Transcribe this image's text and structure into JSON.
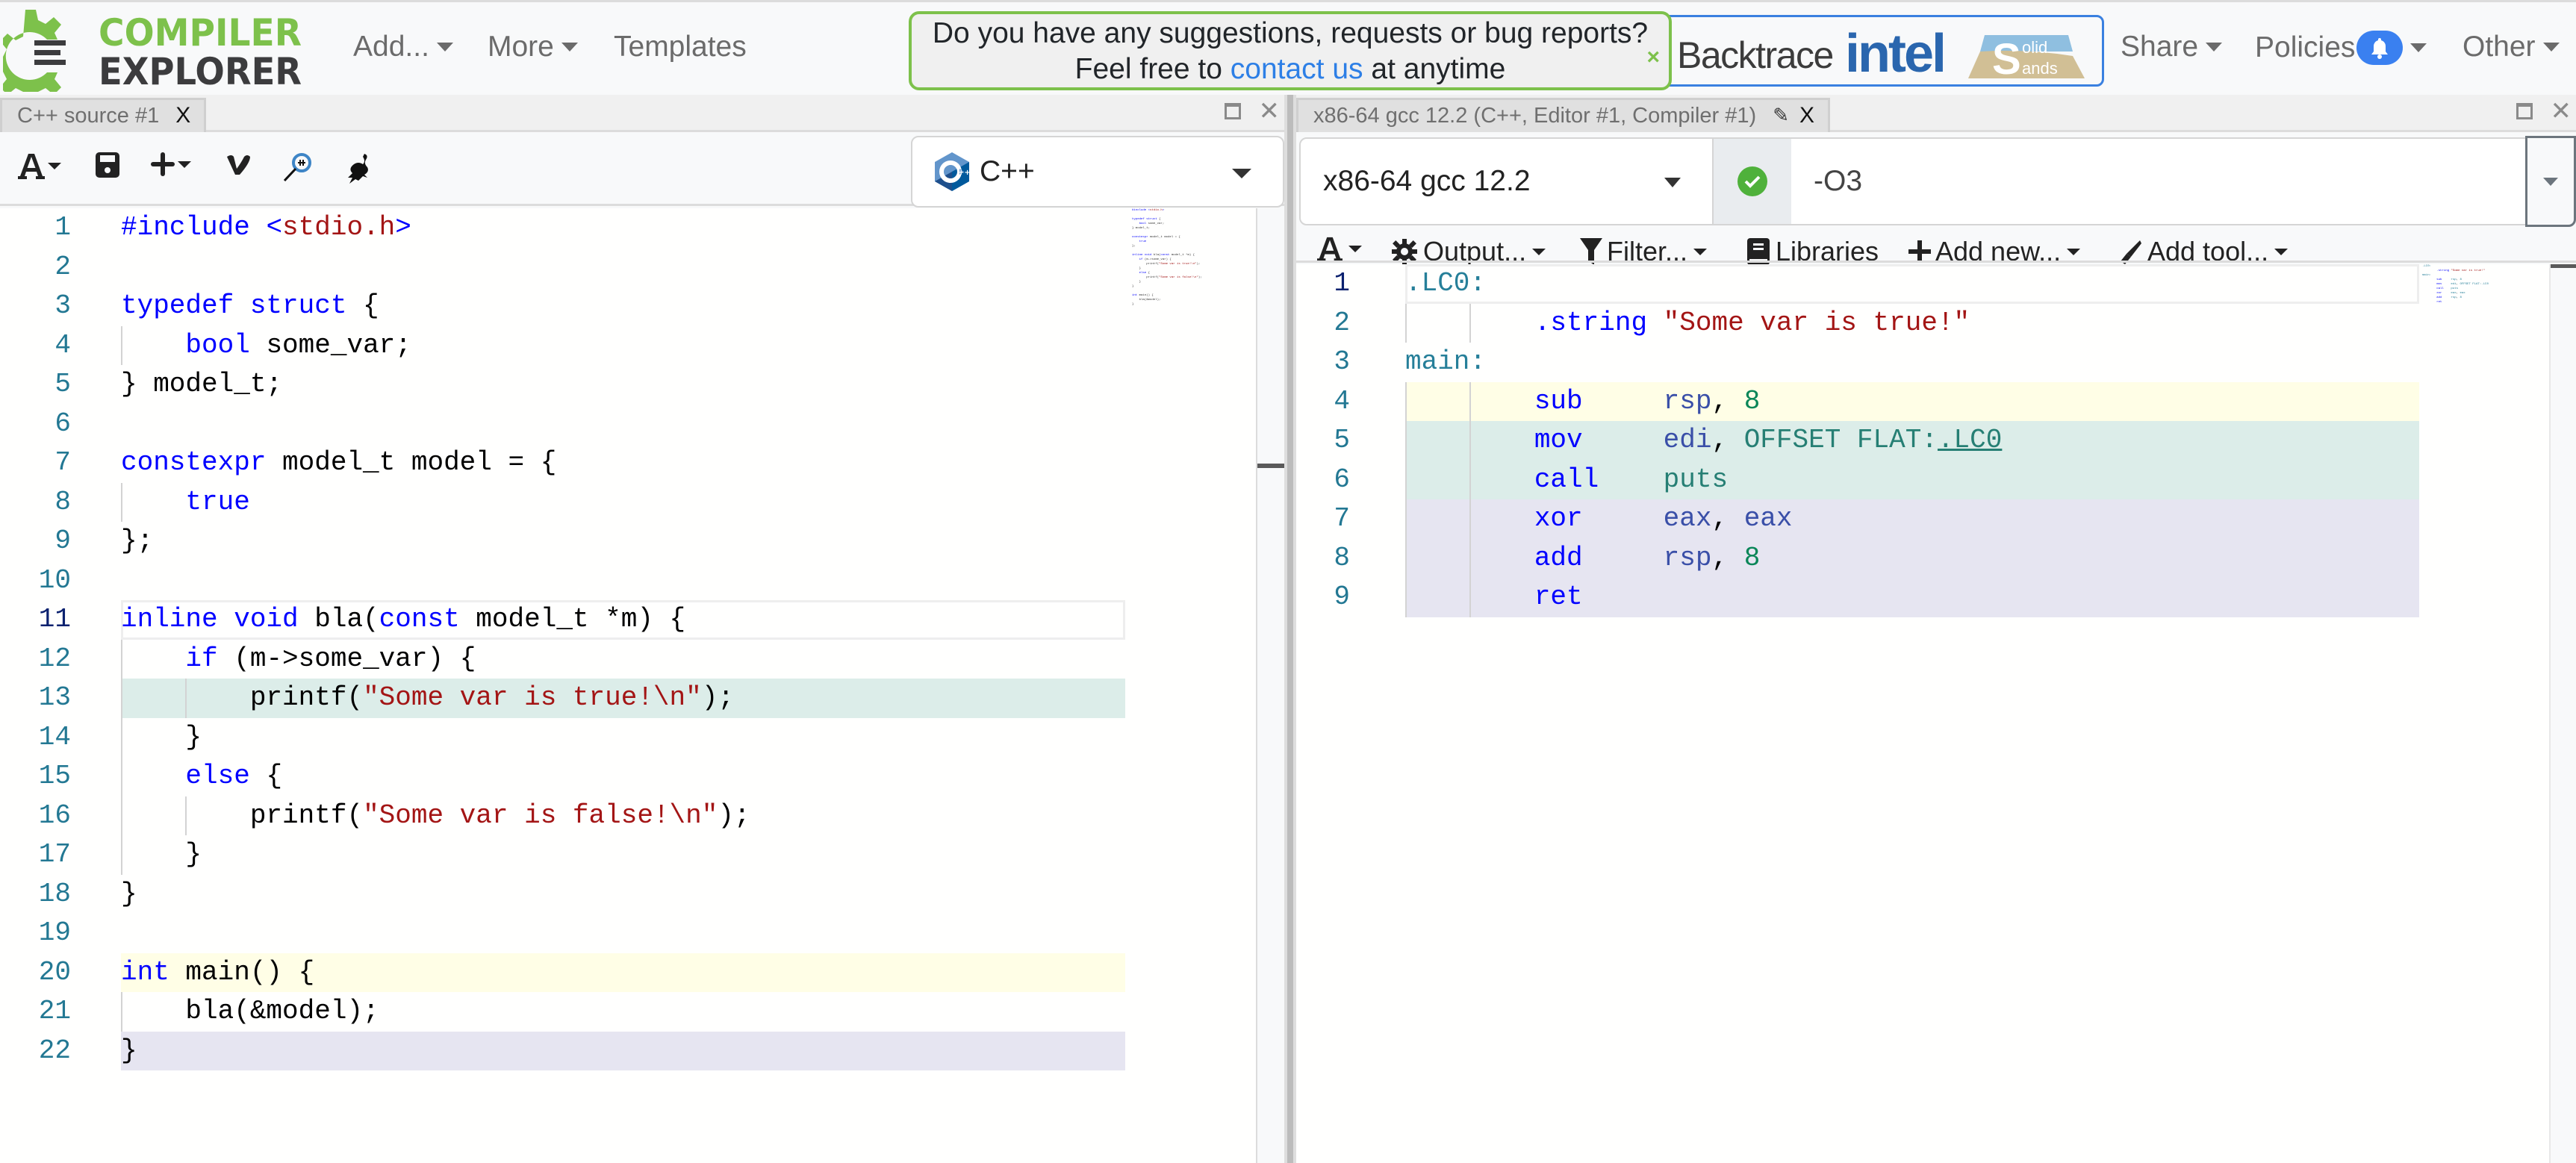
{
  "navbar": {
    "logo_top": "COMPILER",
    "logo_bottom": "EXPLORER",
    "menu": [
      {
        "label": "Add...",
        "has_caret": true
      },
      {
        "label": "More",
        "has_caret": true
      },
      {
        "label": "Templates",
        "has_caret": false
      }
    ],
    "right_menu": [
      {
        "label": "Share",
        "has_caret": true
      },
      {
        "label": "Policies",
        "has_caret": true,
        "badge_icon": "bell-icon"
      },
      {
        "label": "Other",
        "has_caret": true
      }
    ],
    "banner": {
      "line1": "Do you have any suggestions, requests or bug reports?",
      "line2_prefix": "Feel free to",
      "link": "contact us",
      "line2_suffix": "at anytime",
      "close": "×"
    },
    "sponsors": {
      "backtrace": "Backtrace",
      "intel": "intel",
      "solid_top": "olid",
      "solid_bottom": "ands",
      "solid_letter": "S"
    }
  },
  "editor": {
    "tab_title": "C++ source #1",
    "tab_close": "X",
    "language": "C++",
    "toolbar_icons": [
      "font-size-icon",
      "save-icon",
      "add-icon",
      "vim-icon",
      "cppinsights-icon",
      "quick-bench-icon"
    ],
    "lines": [
      [
        {
          "t": "#include ",
          "c": "kw"
        },
        {
          "t": "<",
          "c": "kw"
        },
        {
          "t": "stdio.h",
          "c": "str"
        },
        {
          "t": ">",
          "c": "kw"
        }
      ],
      [],
      [
        {
          "t": "typedef struct",
          "c": "kw"
        },
        {
          "t": " {"
        }
      ],
      [
        {
          "t": "    "
        },
        {
          "t": "bool",
          "c": "kw"
        },
        {
          "t": " some_var;"
        }
      ],
      [
        {
          "t": "} model_t;"
        }
      ],
      [],
      [
        {
          "t": "constexpr",
          "c": "kw"
        },
        {
          "t": " model_t model = {"
        }
      ],
      [
        {
          "t": "    "
        },
        {
          "t": "true",
          "c": "kw"
        }
      ],
      [
        {
          "t": "};"
        }
      ],
      [],
      [
        {
          "t": "inline void",
          "c": "kw"
        },
        {
          "t": " bla("
        },
        {
          "t": "const",
          "c": "kw"
        },
        {
          "t": " model_t *m) {"
        }
      ],
      [
        {
          "t": "    "
        },
        {
          "t": "if",
          "c": "kw"
        },
        {
          "t": " (m->some_var) {"
        }
      ],
      [
        {
          "t": "        printf("
        },
        {
          "t": "\"Some var is true!\\n\"",
          "c": "str"
        },
        {
          "t": ");"
        }
      ],
      [
        {
          "t": "    }"
        }
      ],
      [
        {
          "t": "    "
        },
        {
          "t": "else",
          "c": "kw"
        },
        {
          "t": " {"
        }
      ],
      [
        {
          "t": "        printf("
        },
        {
          "t": "\"Some var is false!\\n\"",
          "c": "str"
        },
        {
          "t": ");"
        }
      ],
      [
        {
          "t": "    }"
        }
      ],
      [
        {
          "t": "}"
        }
      ],
      [],
      [
        {
          "t": "int",
          "c": "kw"
        },
        {
          "t": " main() {"
        }
      ],
      [
        {
          "t": "    bla(&model);"
        }
      ],
      [
        {
          "t": "}"
        }
      ]
    ],
    "line_highlights": {
      "11": "current",
      "13": "#dcede9",
      "20": "#fffee6",
      "22": "#e6e5f1"
    }
  },
  "compiler": {
    "tab_title": "x86-64 gcc 12.2 (C++, Editor #1, Compiler #1)",
    "tab_close": "X",
    "compiler_name": "x86-64 gcc 12.2",
    "status": "success",
    "options": "-O3",
    "toolbar": [
      {
        "icon": "font-size-icon",
        "label": "",
        "caret": true
      },
      {
        "icon": "gear-icon",
        "label": "Output...",
        "caret": true
      },
      {
        "icon": "filter-icon",
        "label": "Filter...",
        "caret": true
      },
      {
        "icon": "book-icon",
        "label": "Libraries",
        "caret": false
      },
      {
        "icon": "plus-icon",
        "label": "Add new...",
        "caret": true
      },
      {
        "icon": "wrench-icon",
        "label": "Add tool...",
        "caret": true
      }
    ],
    "asm": [
      [
        {
          "t": ".LC0:",
          "c": "lbl"
        }
      ],
      [
        {
          "t": "        "
        },
        {
          "t": ".string",
          "c": "kw"
        },
        {
          "t": " "
        },
        {
          "t": "\"Some var is true!\"",
          "c": "str"
        }
      ],
      [
        {
          "t": "main:",
          "c": "lbl"
        }
      ],
      [
        {
          "t": "        "
        },
        {
          "t": "sub",
          "c": "kw"
        },
        {
          "t": "     "
        },
        {
          "t": "rsp",
          "c": "reg"
        },
        {
          "t": ", "
        },
        {
          "t": "8",
          "c": "num"
        }
      ],
      [
        {
          "t": "        "
        },
        {
          "t": "mov",
          "c": "kw"
        },
        {
          "t": "     "
        },
        {
          "t": "edi",
          "c": "reg"
        },
        {
          "t": ", "
        },
        {
          "t": "OFFSET FLAT:",
          "c": "flat"
        },
        {
          "t": ".LC0",
          "c": "link"
        }
      ],
      [
        {
          "t": "        "
        },
        {
          "t": "call",
          "c": "kw"
        },
        {
          "t": "    "
        },
        {
          "t": "puts",
          "c": "flat"
        }
      ],
      [
        {
          "t": "        "
        },
        {
          "t": "xor",
          "c": "kw"
        },
        {
          "t": "     "
        },
        {
          "t": "eax",
          "c": "reg"
        },
        {
          "t": ", "
        },
        {
          "t": "eax",
          "c": "reg"
        }
      ],
      [
        {
          "t": "        "
        },
        {
          "t": "add",
          "c": "kw"
        },
        {
          "t": "     "
        },
        {
          "t": "rsp",
          "c": "reg"
        },
        {
          "t": ", "
        },
        {
          "t": "8",
          "c": "num"
        }
      ],
      [
        {
          "t": "        "
        },
        {
          "t": "ret",
          "c": "kw"
        }
      ]
    ],
    "line_highlights": {
      "1": "current",
      "4": "#fffee6",
      "5": "#dcede9",
      "6": "#dcede9",
      "7": "#e6e5f1",
      "8": "#e6e5f1",
      "9": "#e6e5f1"
    }
  },
  "colors": {
    "brand_green": "#7dc14b",
    "brand_dark": "#3c3c3e",
    "link_blue": "#2d7fe6",
    "status_green": "#4fb13b",
    "line_number": "#237893"
  }
}
